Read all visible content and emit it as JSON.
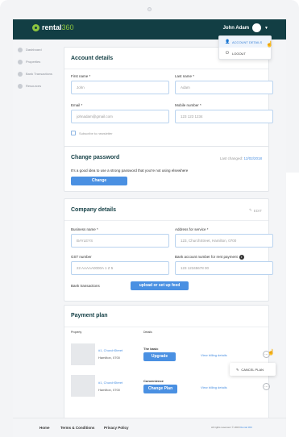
{
  "app": {
    "brand_main": "rental",
    "brand_accent": "360",
    "user_name": "John Adam"
  },
  "user_menu": {
    "items": [
      {
        "label": "ACCOUNT DETAILS",
        "icon": "person-icon"
      },
      {
        "label": "LOGOUT",
        "icon": "power-icon"
      }
    ]
  },
  "sidebar": {
    "items": [
      {
        "label": "Dashboard"
      },
      {
        "label": "Properties"
      },
      {
        "label": "Bank Transactions"
      },
      {
        "label": "Resources"
      }
    ]
  },
  "account": {
    "title": "Account details",
    "first_name_label": "First name *",
    "first_name_value": "John",
    "last_name_label": "Last name *",
    "last_name_value": "Adam",
    "email_label": "Email *",
    "email_value": "johnadam@gmail.com",
    "mobile_label": "Mobile number *",
    "mobile_value": "123 123 1234",
    "newsletter_label": "Subscribe to newsletter"
  },
  "password": {
    "title": "Change password",
    "last_changed_label": "Last changed:",
    "last_changed_date": "12/02/2018",
    "hint": "It's a good idea to use a strong password that you're not using elsewhere",
    "button": "Change"
  },
  "company": {
    "title": "Company details",
    "edit_label": "EDIT",
    "business_label": "Business name *",
    "business_value": "BAYLEYS",
    "address_label": "Address for service *",
    "address_value": "123, ChurchStreet, Hamilton, 0700",
    "gst_label": "GST number",
    "gst_value": "22 AAAAA0000A 1 Z 5",
    "bank_label": "Bank account number for rent payment",
    "bank_value": "123 12345678 00",
    "bank_tx_label": "Bank transactions",
    "upload_button": "upload or set up feed"
  },
  "payment": {
    "title": "Payment plan",
    "col_property": "Property",
    "col_details": "Details",
    "rows": [
      {
        "address": "#1, ChurchStreet",
        "city": "Hamilton, 0700",
        "plan": "The basic",
        "button": "Upgrade",
        "billing": "View billing details"
      },
      {
        "address": "#1, ChurchStreet",
        "city": "Hamilton, 0700",
        "plan": "Convenience",
        "button": "Change Plan",
        "billing": "View billing details"
      }
    ],
    "cancel_label": "CANCEL PLAN"
  },
  "footer": {
    "home": "Home",
    "terms": "Terms & Conditions",
    "privacy": "Privacy Policy",
    "copyright": "All rights reserved. © 2018",
    "copyright_brand": "Rental 360"
  },
  "colors": {
    "header": "#123e44",
    "brand_green": "#8ec63f",
    "accent_blue": "#4a90e2"
  }
}
